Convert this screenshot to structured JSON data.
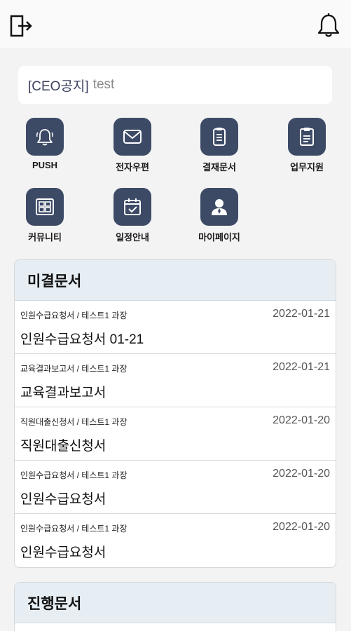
{
  "header": {
    "exit_icon": "logout-icon",
    "bell_icon": "bell-icon"
  },
  "notice": {
    "tag": "[CEO공지]",
    "message": "test"
  },
  "menu": [
    {
      "label": "PUSH",
      "icon": "bell-icon"
    },
    {
      "label": "전자우편",
      "icon": "mail-icon"
    },
    {
      "label": "결재문서",
      "icon": "clipboard-icon"
    },
    {
      "label": "업무지원",
      "icon": "clipboard-list-icon"
    },
    {
      "label": "커뮤니티",
      "icon": "community-icon"
    },
    {
      "label": "일정안내",
      "icon": "calendar-icon"
    },
    {
      "label": "마이페이지",
      "icon": "user-icon"
    }
  ],
  "pending": {
    "title": "미결문서",
    "items": [
      {
        "meta": "인원수급요청서 / 테스트1 과장",
        "date": "2022-01-21",
        "title": "인원수급요청서 01-21"
      },
      {
        "meta": "교육결과보고서 / 테스트1 과장",
        "date": "2022-01-21",
        "title": "교육결과보고서"
      },
      {
        "meta": "직원대출신청서 / 테스트1 과장",
        "date": "2022-01-20",
        "title": "직원대출신청서"
      },
      {
        "meta": "인원수급요청서 / 테스트1 과장",
        "date": "2022-01-20",
        "title": "인원수급요청서"
      },
      {
        "meta": "인원수급요청서 / 테스트1 과장",
        "date": "2022-01-20",
        "title": "인원수급요청서"
      }
    ]
  },
  "progress": {
    "title": "진행문서"
  },
  "colors": {
    "icon_bg": "#3c4a66",
    "panel_head": "#e6eef4",
    "notice_tag": "#3a3f5e"
  }
}
